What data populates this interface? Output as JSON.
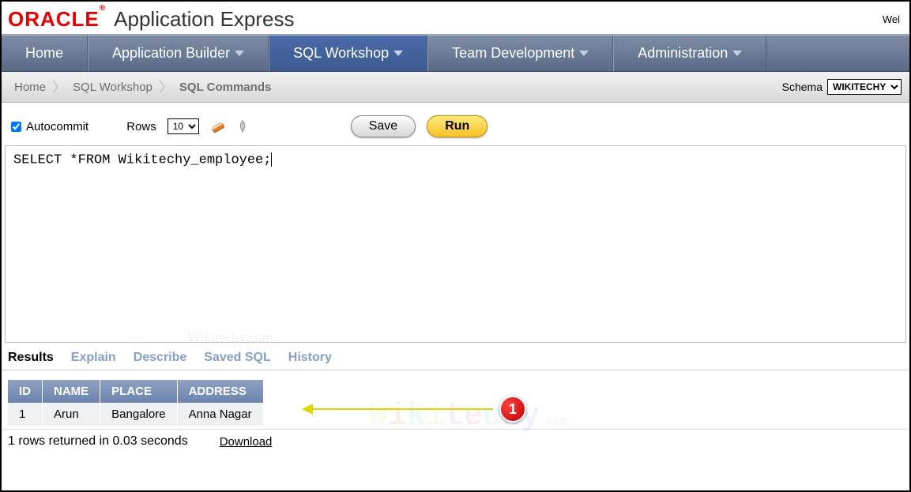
{
  "header": {
    "logo": "ORACLE",
    "logo_sup": "®",
    "title": "Application Express",
    "right_text": "Wel"
  },
  "nav": {
    "items": [
      {
        "label": "Home",
        "has_caret": false,
        "active": false
      },
      {
        "label": "Application Builder",
        "has_caret": true,
        "active": false
      },
      {
        "label": "SQL Workshop",
        "has_caret": true,
        "active": true
      },
      {
        "label": "Team Development",
        "has_caret": true,
        "active": false
      },
      {
        "label": "Administration",
        "has_caret": true,
        "active": false
      }
    ]
  },
  "breadcrumb": {
    "items": [
      "Home",
      "SQL Workshop",
      "SQL Commands"
    ],
    "schema_label": "Schema",
    "schema_value": "WIKITECHY"
  },
  "toolbar": {
    "autocommit_label": "Autocommit",
    "autocommit_checked": true,
    "rows_label": "Rows",
    "rows_value": "10",
    "save_label": "Save",
    "run_label": "Run"
  },
  "editor": {
    "sql": "SELECT *FROM  Wikitechy_employee;"
  },
  "results": {
    "tabs": [
      "Results",
      "Explain",
      "Describe",
      "Saved SQL",
      "History"
    ],
    "active_tab": 0,
    "columns": [
      "ID",
      "NAME",
      "PLACE",
      "ADDRESS"
    ],
    "rows": [
      {
        "ID": "1",
        "NAME": "Arun",
        "PLACE": "Bangalore",
        "ADDRESS": "Anna Nagar"
      }
    ],
    "status": "1 rows returned in 0.03 seconds",
    "download_label": "Download"
  },
  "annotation": {
    "number": "1"
  },
  "watermark": {
    "text": "Wikitechy",
    "small": ".com"
  }
}
